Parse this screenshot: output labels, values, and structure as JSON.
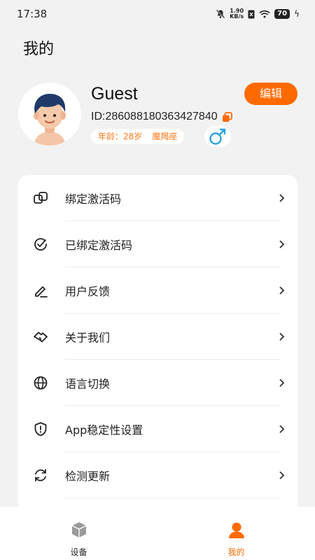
{
  "status_bar": {
    "time": "17:38",
    "net_speed_value": "1.90",
    "net_speed_unit": "KB/s",
    "battery": "70",
    "icons": [
      "mute-bell-icon",
      "sim-icon",
      "wifi-icon",
      "battery-icon",
      "charging-icon"
    ]
  },
  "page": {
    "title": "我的"
  },
  "profile": {
    "name": "Guest",
    "id": "ID:286088180363427840",
    "edit_label": "编辑",
    "age": "年龄：28岁",
    "zodiac": "魔羯座",
    "gender": "♂"
  },
  "menu": [
    {
      "label": "绑定激活码",
      "icon": "bind-code-icon"
    },
    {
      "label": "已绑定激活码",
      "icon": "check-circle-icon"
    },
    {
      "label": "用户反馈",
      "icon": "pen-icon"
    },
    {
      "label": "关于我们",
      "icon": "handshake-icon"
    },
    {
      "label": "语言切换",
      "icon": "globe-icon"
    },
    {
      "label": "App稳定性设置",
      "icon": "shield-icon"
    },
    {
      "label": "检测更新",
      "icon": "refresh-icon"
    }
  ],
  "nav": {
    "tabs": [
      {
        "label": "设备",
        "icon": "cube-icon",
        "active": false
      },
      {
        "label": "我的",
        "icon": "person-icon",
        "active": true
      }
    ]
  },
  "colors": {
    "accent": "#ff6a00",
    "background": "#f2f2f2",
    "gender_blue": "#2aa3e0"
  }
}
